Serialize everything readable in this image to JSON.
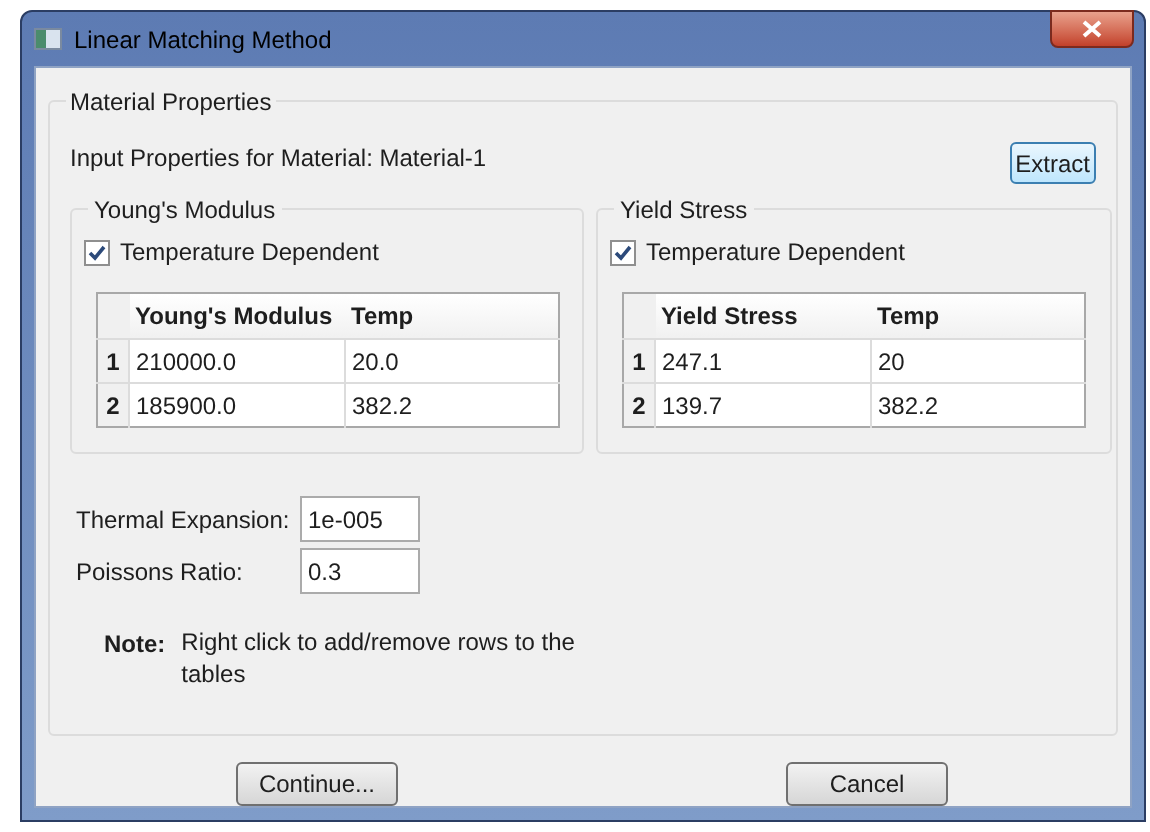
{
  "window": {
    "title": "Linear Matching Method"
  },
  "material_properties": {
    "title": "Material Properties",
    "input_label": "Input Properties for Material: Material-1",
    "extract_button": "Extract"
  },
  "groups": [
    {
      "title": "Young's Modulus",
      "checkbox": {
        "label": "Temperature Dependent",
        "checked": true
      },
      "table": {
        "columns": [
          "Young's Modulus",
          "Temp"
        ],
        "rows": [
          {
            "index": "1",
            "cells": [
              "210000.0",
              "20.0"
            ]
          },
          {
            "index": "2",
            "cells": [
              "185900.0",
              "382.2"
            ]
          }
        ]
      }
    },
    {
      "title": "Yield Stress",
      "checkbox": {
        "label": "Temperature Dependent",
        "checked": true
      },
      "table": {
        "columns": [
          "Yield Stress",
          "Temp"
        ],
        "rows": [
          {
            "index": "1",
            "cells": [
              "247.1",
              "20"
            ]
          },
          {
            "index": "2",
            "cells": [
              "139.7",
              "382.2"
            ]
          }
        ]
      }
    }
  ],
  "fields": [
    {
      "label": "Thermal Expansion:",
      "value": "1e-005"
    },
    {
      "label": "Poissons Ratio:",
      "value": "0.3"
    }
  ],
  "note": {
    "label": "Note:",
    "text": "Right click to add/remove rows to the tables"
  },
  "buttons": [
    "Continue...",
    "Cancel"
  ]
}
